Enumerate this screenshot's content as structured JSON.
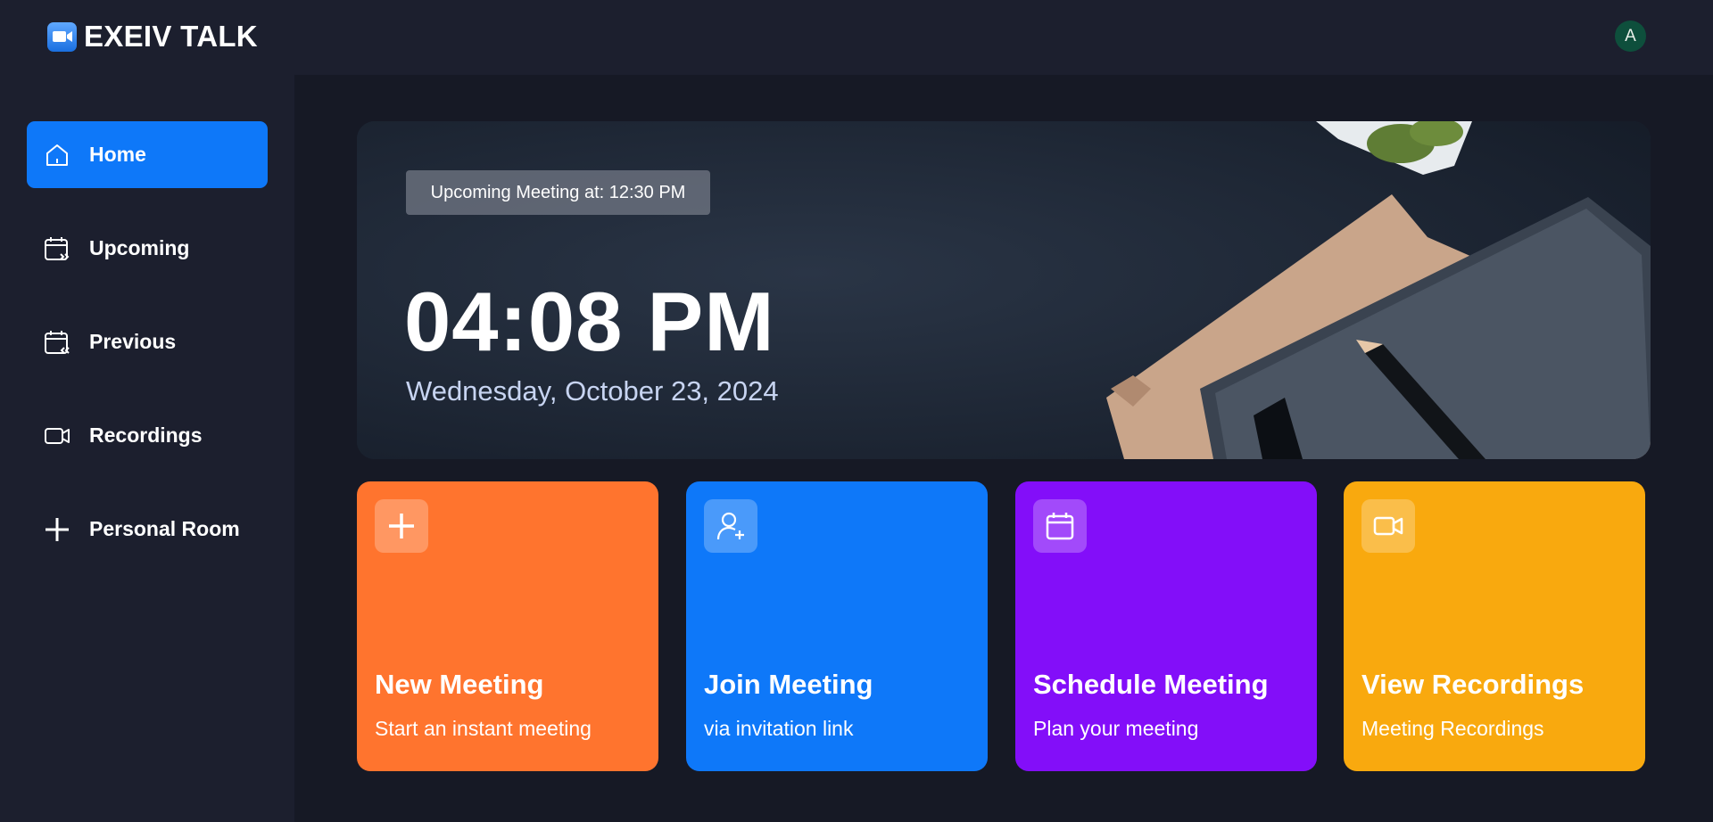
{
  "app": {
    "name": "EXEIV TALK",
    "user_initial": "A"
  },
  "sidebar": {
    "items": [
      {
        "label": "Home",
        "icon": "home-icon",
        "active": true
      },
      {
        "label": "Upcoming",
        "icon": "calendar-forward-icon"
      },
      {
        "label": "Previous",
        "icon": "calendar-back-icon"
      },
      {
        "label": "Recordings",
        "icon": "video-icon"
      },
      {
        "label": "Personal Room",
        "icon": "plus-icon"
      }
    ]
  },
  "hero": {
    "upcoming": "Upcoming Meeting at: 12:30 PM",
    "time": "04:08 PM",
    "date": "Wednesday, October 23, 2024"
  },
  "cards": [
    {
      "title": "New Meeting",
      "subtitle": "Start an instant meeting",
      "icon": "plus-icon",
      "color": "#ff742e"
    },
    {
      "title": "Join Meeting",
      "subtitle": "via invitation link",
      "icon": "user-add-icon",
      "color": "#0e78f9"
    },
    {
      "title": "Schedule Meeting",
      "subtitle": "Plan your meeting",
      "icon": "calendar-icon",
      "color": "#830ef9"
    },
    {
      "title": "View Recordings",
      "subtitle": "Meeting Recordings",
      "icon": "video-icon",
      "color": "#f9a90e"
    }
  ],
  "colors": {
    "background": "#161925",
    "panel": "#1c1f2e",
    "accent": "#0e78f9"
  }
}
